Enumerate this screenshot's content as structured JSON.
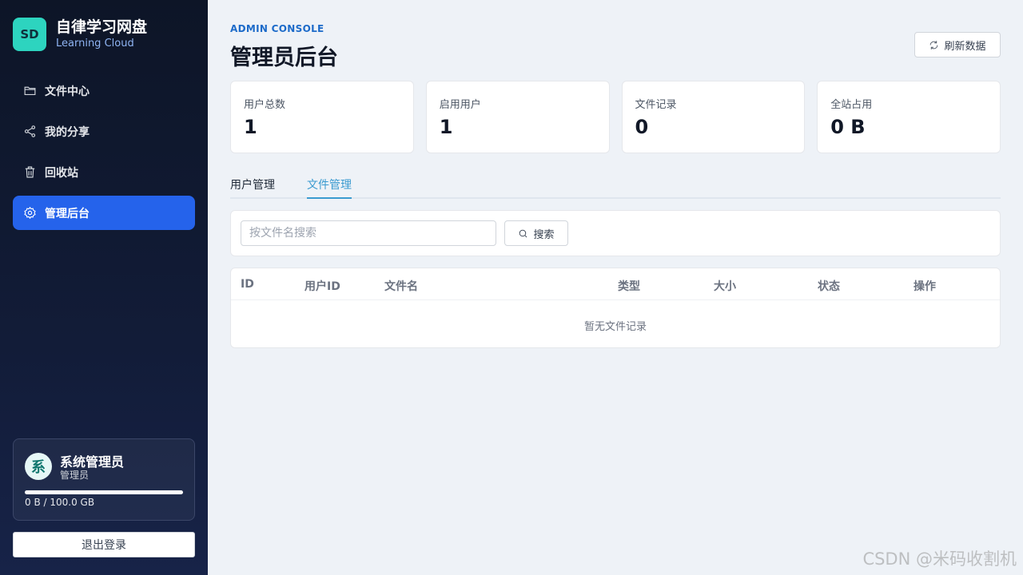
{
  "brand": {
    "logo": "SD",
    "title": "自律学习网盘",
    "subtitle": "Learning Cloud"
  },
  "nav": [
    {
      "label": "文件中心",
      "icon": "folder-icon",
      "active": false
    },
    {
      "label": "我的分享",
      "icon": "share-icon",
      "active": false
    },
    {
      "label": "回收站",
      "icon": "trash-icon",
      "active": false
    },
    {
      "label": "管理后台",
      "icon": "gear-icon",
      "active": true
    }
  ],
  "user": {
    "avatar": "系",
    "name": "系统管理员",
    "role": "管理员",
    "quota_text": "0 B / 100.0 GB",
    "quota_used_fraction": 0
  },
  "logout_label": "退出登录",
  "header": {
    "eyebrow": "ADMIN CONSOLE",
    "title": "管理员后台",
    "refresh_label": "刷新数据"
  },
  "stats": [
    {
      "label": "用户总数",
      "value": "1"
    },
    {
      "label": "启用用户",
      "value": "1"
    },
    {
      "label": "文件记录",
      "value": "0"
    },
    {
      "label": "全站占用",
      "value": "0 B"
    }
  ],
  "tabs": [
    {
      "label": "用户管理",
      "active": false
    },
    {
      "label": "文件管理",
      "active": true
    }
  ],
  "search": {
    "placeholder": "按文件名搜索",
    "value": "",
    "button_label": "搜索"
  },
  "table": {
    "columns": [
      "ID",
      "用户ID",
      "文件名",
      "类型",
      "大小",
      "状态",
      "操作"
    ],
    "empty_text": "暂无文件记录"
  },
  "watermark": "CSDN @米码收割机",
  "colors": {
    "accent": "#2563eb",
    "tab_active": "#3b9bd0",
    "logo_bg": "#2dd4bf"
  }
}
